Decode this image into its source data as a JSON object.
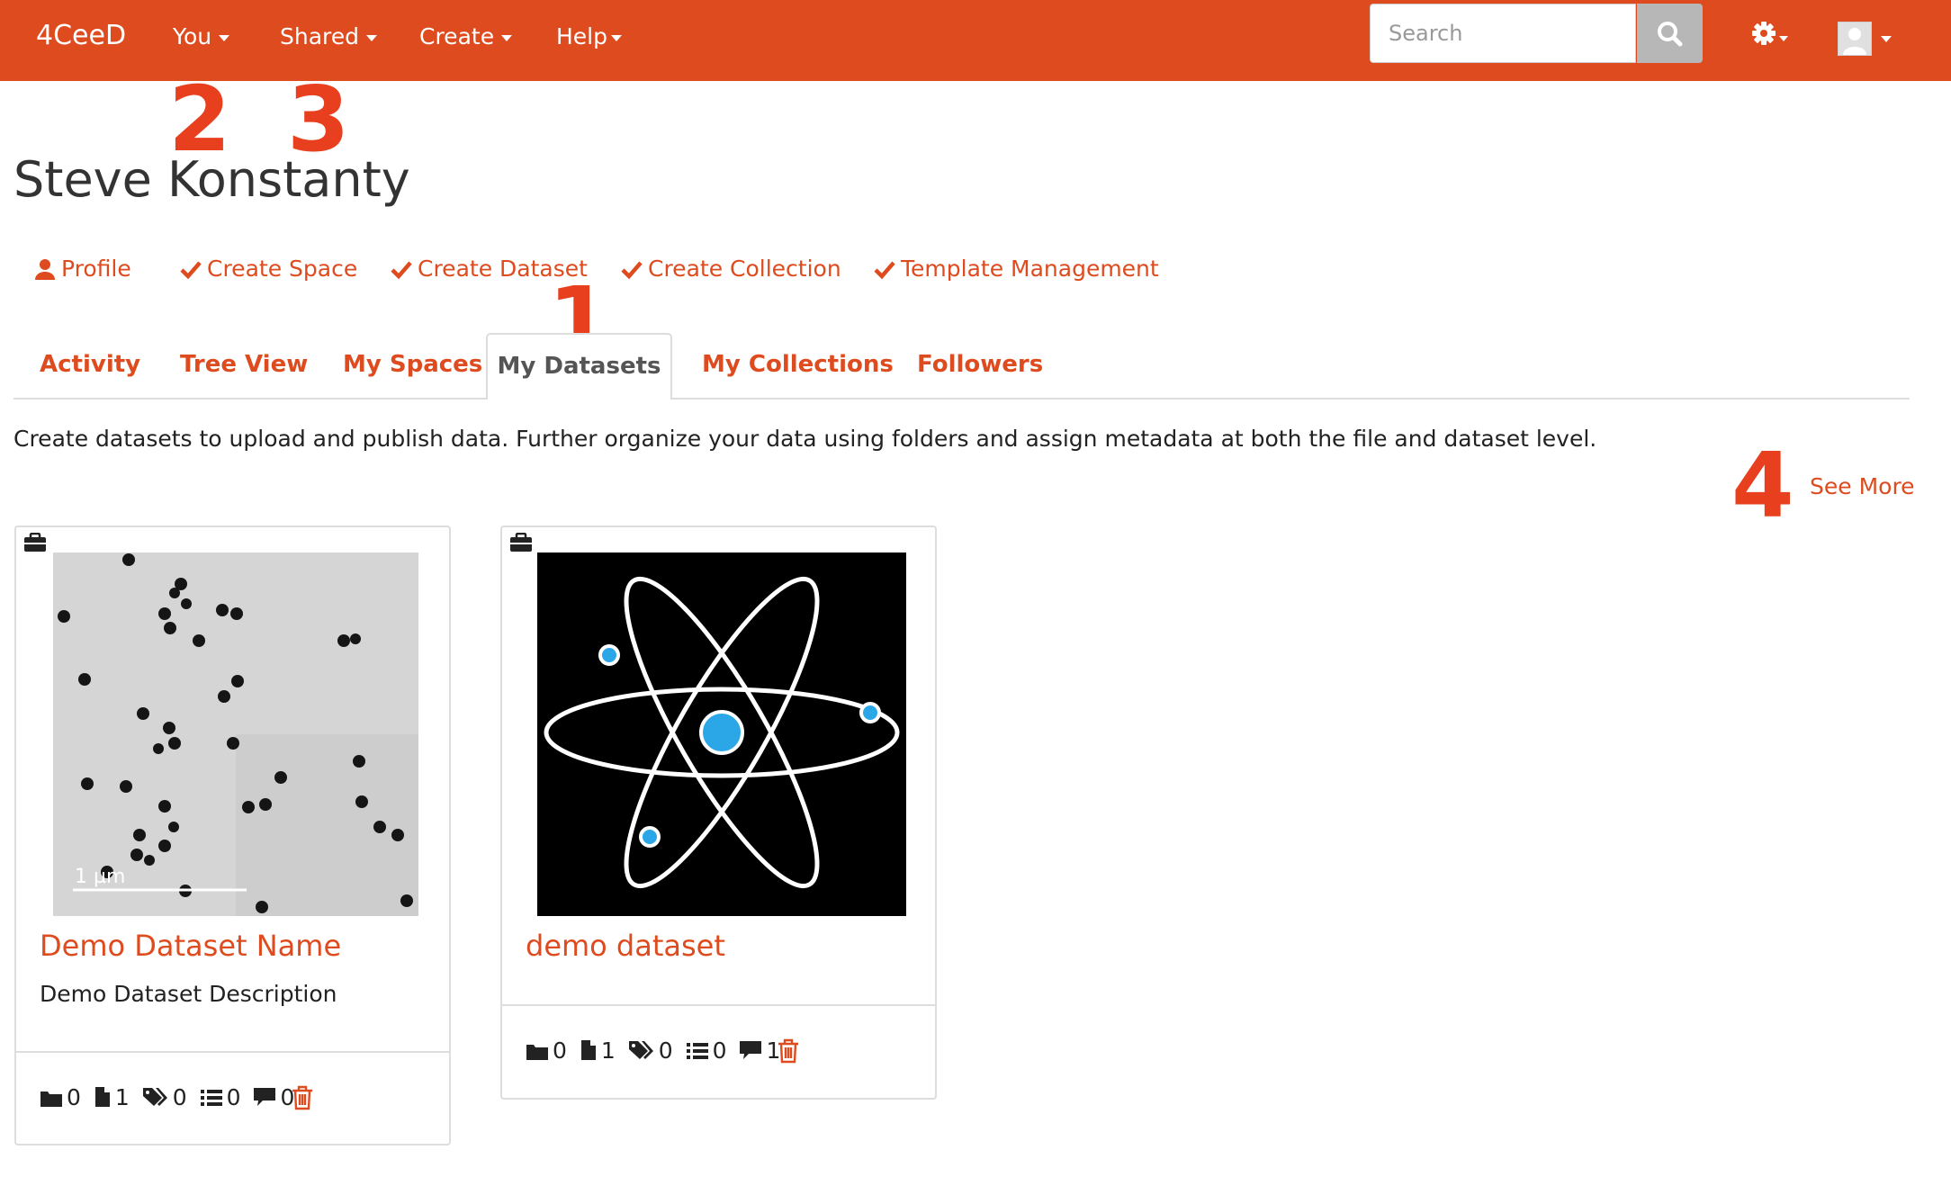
{
  "app": {
    "brand": "4CeeD"
  },
  "nav": {
    "you": "You",
    "shared": "Shared",
    "create": "Create",
    "help": "Help"
  },
  "search": {
    "placeholder": "Search"
  },
  "user": {
    "name": "Steve Konstanty"
  },
  "annotations": [
    "1",
    "2",
    "3",
    "4"
  ],
  "actions": [
    {
      "label": "Profile",
      "icon": "user-icon"
    },
    {
      "label": "Create Space",
      "icon": "check-icon"
    },
    {
      "label": "Create Dataset",
      "icon": "check-icon"
    },
    {
      "label": "Create Collection",
      "icon": "check-icon"
    },
    {
      "label": "Template Management",
      "icon": "check-icon"
    }
  ],
  "tabs": [
    {
      "label": "Activity"
    },
    {
      "label": "Tree View"
    },
    {
      "label": "My Spaces"
    },
    {
      "label": "My Datasets",
      "active": true
    },
    {
      "label": "My Collections"
    },
    {
      "label": "Followers"
    }
  ],
  "description": "Create datasets to upload and publish data. Further organize your data using folders and assign metadata at both the file and dataset level.",
  "see_more": "See More",
  "datasets": [
    {
      "title": "Demo Dataset Name",
      "description": "Demo Dataset Description",
      "scale_label": "1 µm",
      "stats": {
        "folders": "0",
        "files": "1",
        "tags": "0",
        "metadata": "0",
        "comments": "0"
      }
    },
    {
      "title": "demo dataset",
      "description": "",
      "stats": {
        "folders": "0",
        "files": "1",
        "tags": "0",
        "metadata": "0",
        "comments": "1"
      }
    }
  ],
  "colors": {
    "accent": "#de4b1e",
    "annotation": "#e8401f",
    "atom_blue": "#2ba7e8"
  }
}
